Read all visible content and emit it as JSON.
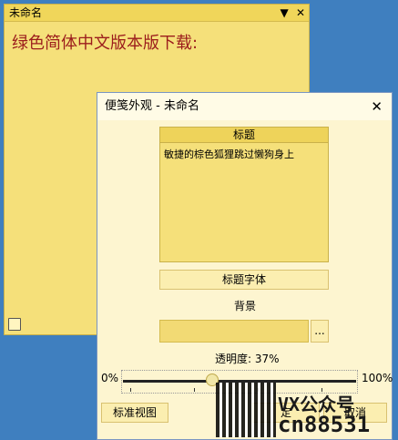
{
  "note": {
    "title": "未命名",
    "dropdown_glyph": "▼",
    "close_glyph": "✕",
    "text": "绿色简体中文版本版下载:"
  },
  "dialog": {
    "title": "便笺外观 - 未命名",
    "close_glyph": "✕",
    "preview_header": "标题",
    "preview_text": "敏捷的棕色狐狸跳过懒狗身上",
    "title_font_button": "标题字体",
    "background_label": "背景",
    "browse_button": "...",
    "transparency_label": "透明度: 37%",
    "transparency_value": 37,
    "slider_min": "0%",
    "slider_max": "100%",
    "standard_view_button": "标准视图",
    "ok_button": "定",
    "cancel_button": "取消"
  },
  "watermark": {
    "line1": "VX公众号",
    "line2": "cn88531"
  }
}
